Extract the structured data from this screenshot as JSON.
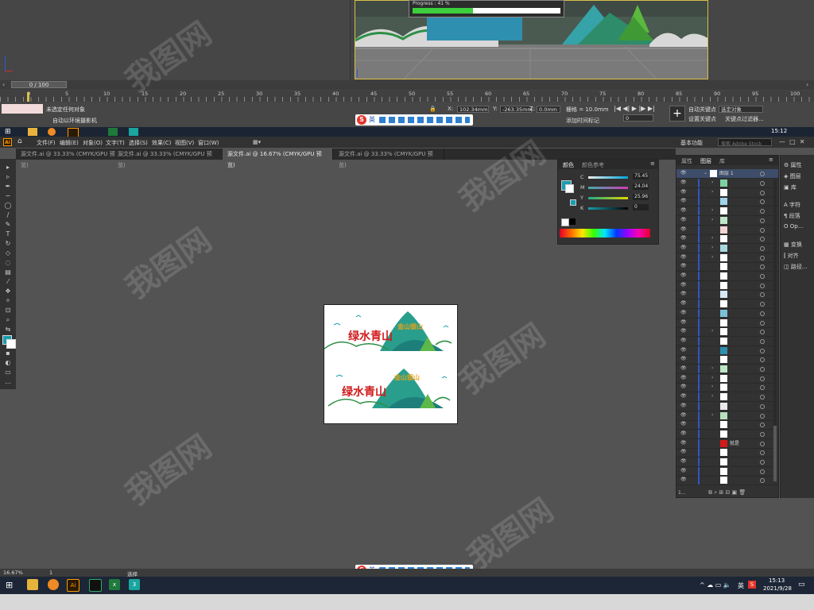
{
  "max": {
    "progress_text": "Progress : 41 %",
    "progress_percent": 41,
    "timeline": {
      "frame_display": "0 / 100",
      "ticks": [
        "0",
        "5",
        "10",
        "15",
        "20",
        "25",
        "30",
        "35",
        "40",
        "45",
        "50",
        "55",
        "60",
        "65",
        "70",
        "75",
        "80",
        "85",
        "90",
        "95",
        "100"
      ]
    },
    "status": {
      "selection_text": "未选定任何对象",
      "camera_text": "自动以环境摄影机",
      "x_label": "X:",
      "x_value": "102.34mm",
      "y_label": "Y:",
      "y_value": "-263.35mm",
      "z_label": "Z:",
      "z_value": "0.0mm",
      "grid_text": "栅格 = 10.0mm",
      "add_tag": "添加时间标记",
      "auto_key": "自动关键点",
      "set_key": "设置关键点",
      "selected_option": "选定对象",
      "key_filter": "关键点过滤器...",
      "frame_value": "0"
    }
  },
  "taskbar_top": {
    "time": "15:12"
  },
  "ai": {
    "logo": "Ai",
    "menus": [
      "文件(F)",
      "编辑(E)",
      "对象(O)",
      "文字(T)",
      "选择(S)",
      "效果(C)",
      "视图(V)",
      "窗口(W)"
    ],
    "workspace": "基本功能",
    "search_placeholder": "搜索 Adobe Stock",
    "tabs": [
      "源文件.ai @ 33.33% (CMYK/GPU 预览)",
      "源文件.ai @ 33.33% (CMYK/GPU 预览)",
      "源文件.ai @ 16.67% (CMYK/GPU 预览)",
      "源文件.ai @ 33.33% (CMYK/GPU 预览)"
    ],
    "artboard": {
      "slogan_big": "绿水青山",
      "slogan_small": "金山银山"
    },
    "color_panel": {
      "tab_color": "颜色",
      "tab_guide": "颜色参考",
      "sliders": [
        {
          "label": "C",
          "value": "75.45",
          "color": "#00a5d8"
        },
        {
          "label": "M",
          "value": "24.04",
          "color": "#d23bb3"
        },
        {
          "label": "Y",
          "value": "25.96",
          "color": "#e0d700"
        },
        {
          "label": "K",
          "value": "0",
          "color": "#555555"
        }
      ],
      "unit": "%",
      "fill_color": "#1a9db0"
    },
    "layers_panel": {
      "tabs": [
        "属性",
        "图层",
        "库"
      ],
      "top_layer": "图层 1",
      "named_item": "就是",
      "footer": "1..."
    },
    "right_dock": [
      "属性",
      "图层",
      "库",
      "字符",
      "段落",
      "Op...",
      "变换",
      "对齐",
      "路径..."
    ],
    "status": {
      "zoom": "16.67%",
      "page": "1",
      "mode": "选择"
    }
  },
  "taskbar_bottom": {
    "time": "15:13",
    "date": "2021/9/28",
    "lang": "英"
  },
  "ime": {
    "label": "英"
  },
  "watermark": "我图网"
}
